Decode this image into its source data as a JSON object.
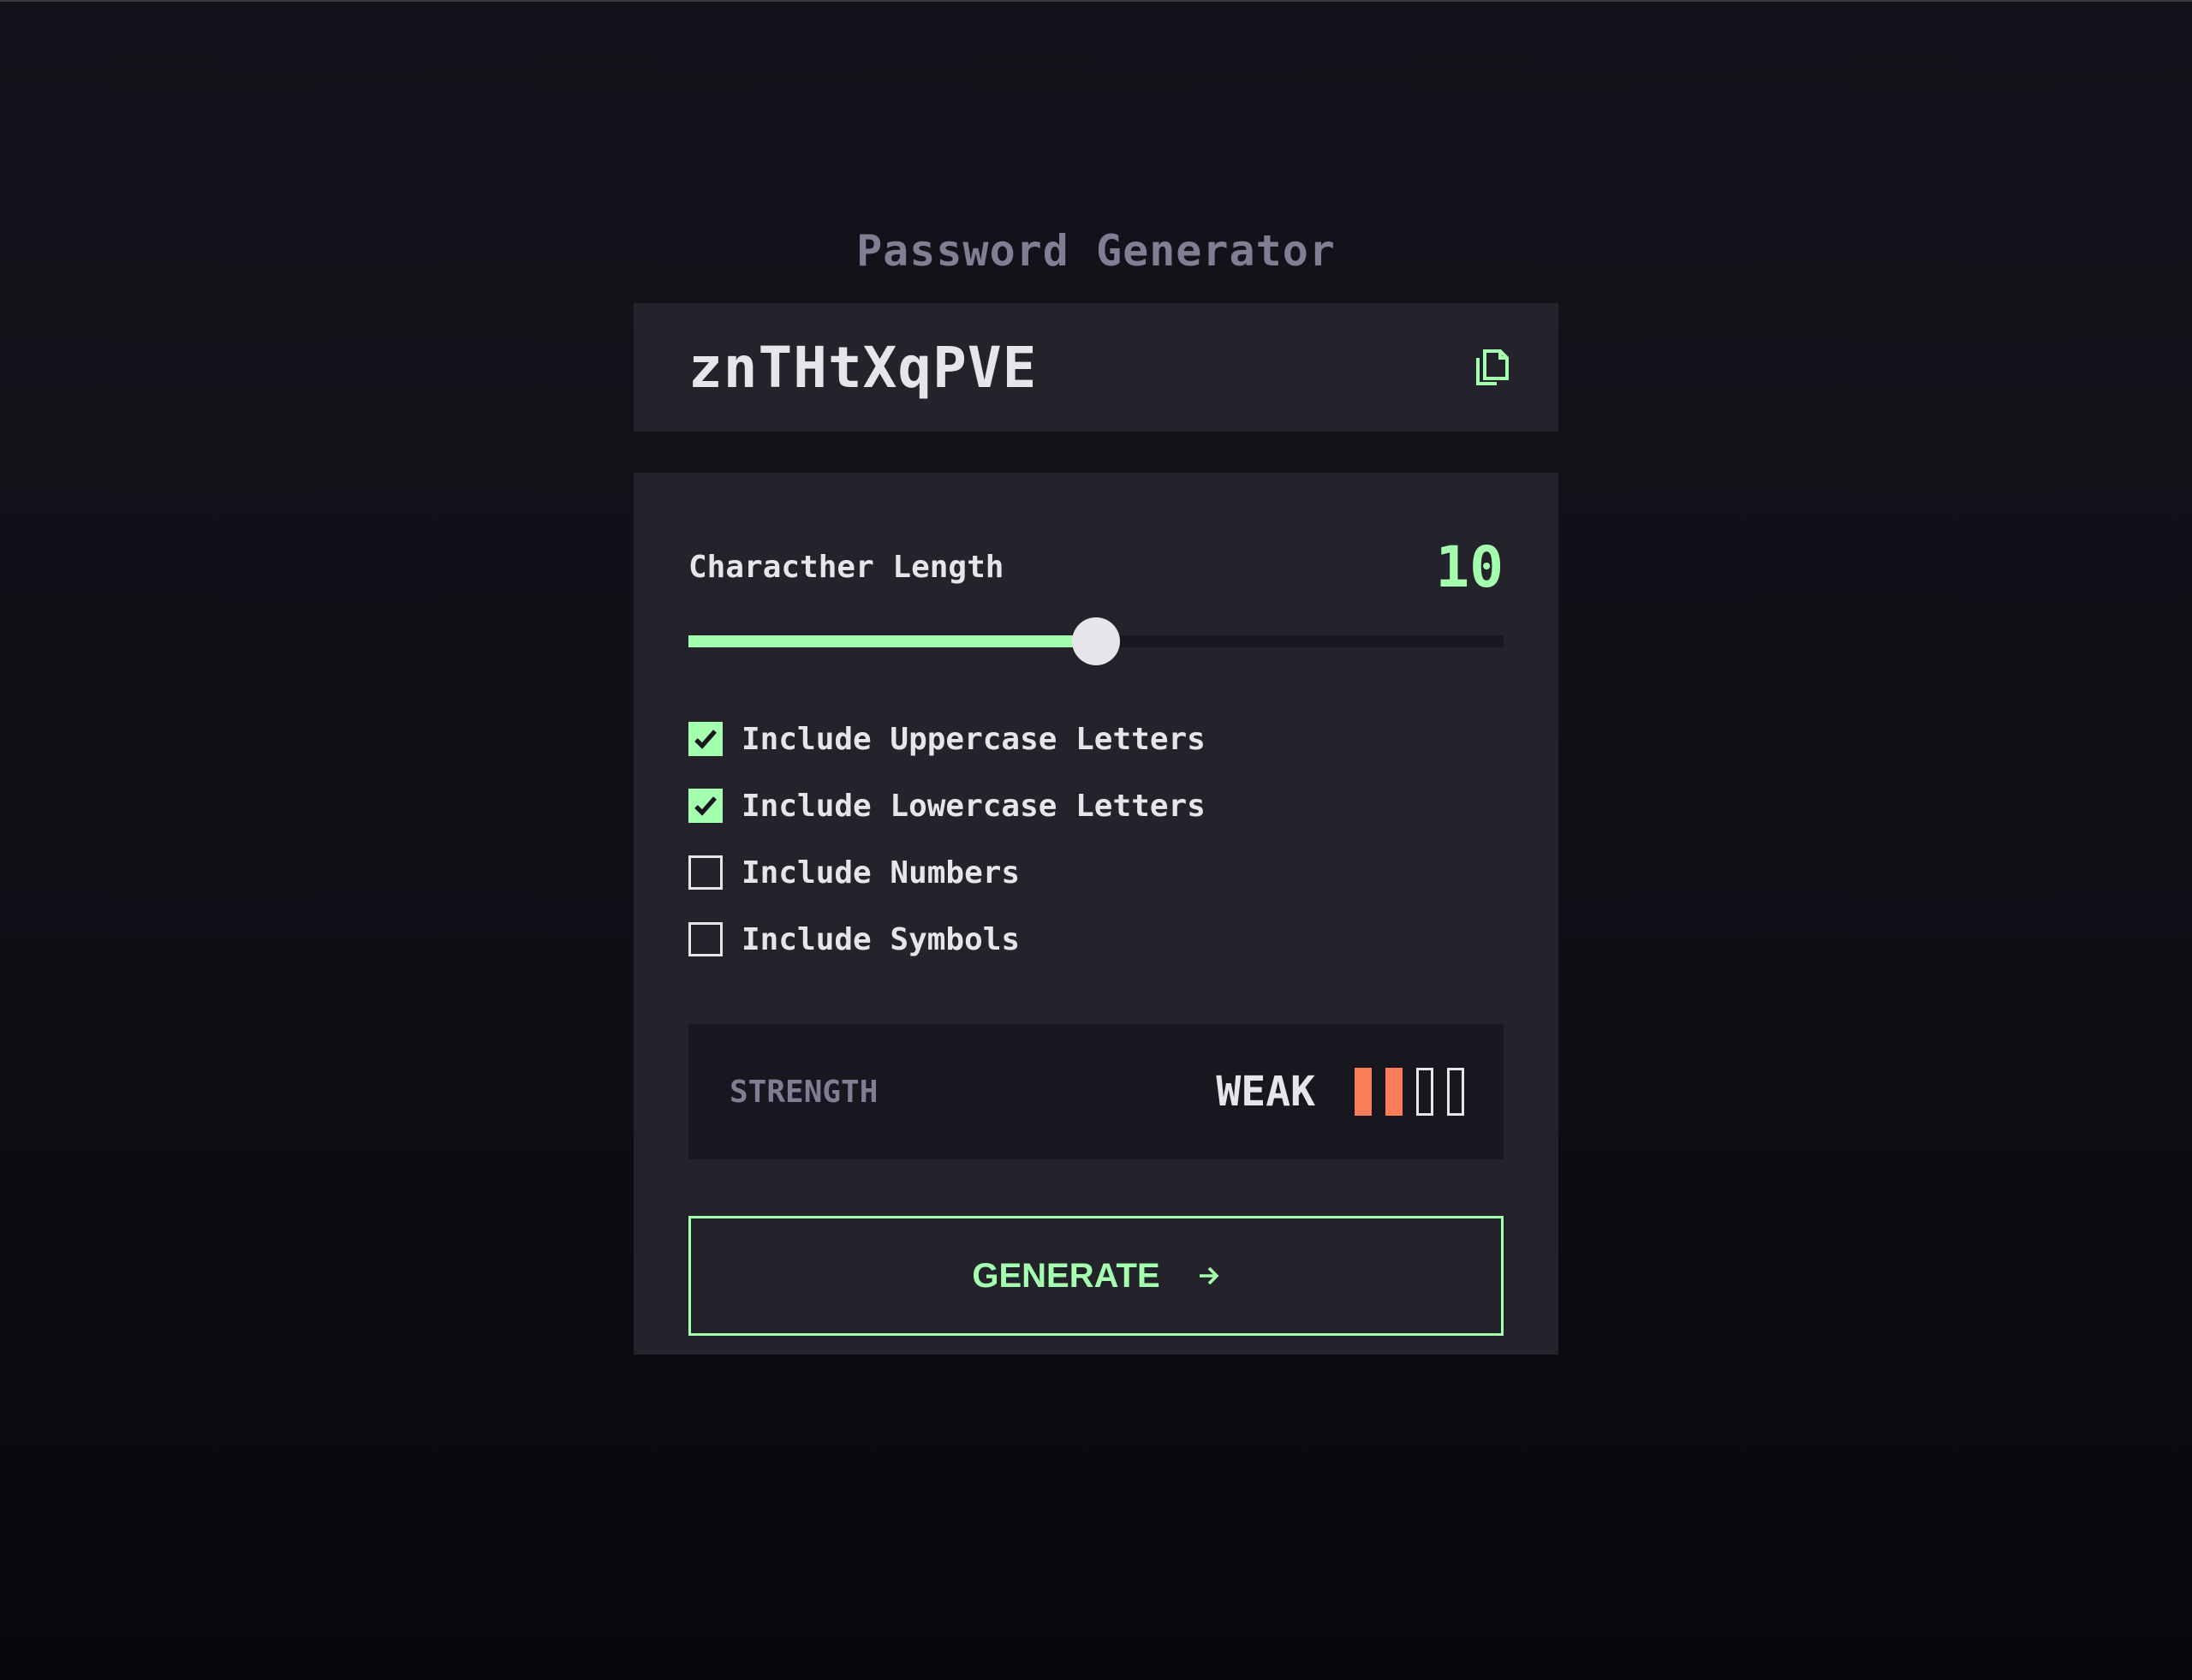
{
  "app": {
    "title": "Password Generator"
  },
  "password": {
    "value": "znTHtXqPVE"
  },
  "length": {
    "label": "Characther Length",
    "value": "10",
    "slider_fraction": 0.5
  },
  "options": [
    {
      "label": "Include Uppercase Letters",
      "checked": true
    },
    {
      "label": "Include Lowercase Letters",
      "checked": true
    },
    {
      "label": "Include Numbers",
      "checked": false
    },
    {
      "label": "Include Symbols",
      "checked": false
    }
  ],
  "strength": {
    "label": "STRENGTH",
    "level": "WEAK",
    "bars_total": 4,
    "bars_filled": 2
  },
  "generate": {
    "label": "GENERATE"
  },
  "colors": {
    "accent": "#a4ffaf",
    "weak": "#fb7c58",
    "panel": "#24232c",
    "text": "#e6e5ea",
    "muted": "#817d92"
  },
  "icons": {
    "copy": "copy-icon",
    "arrow": "arrow-right-icon",
    "check": "check-icon"
  }
}
